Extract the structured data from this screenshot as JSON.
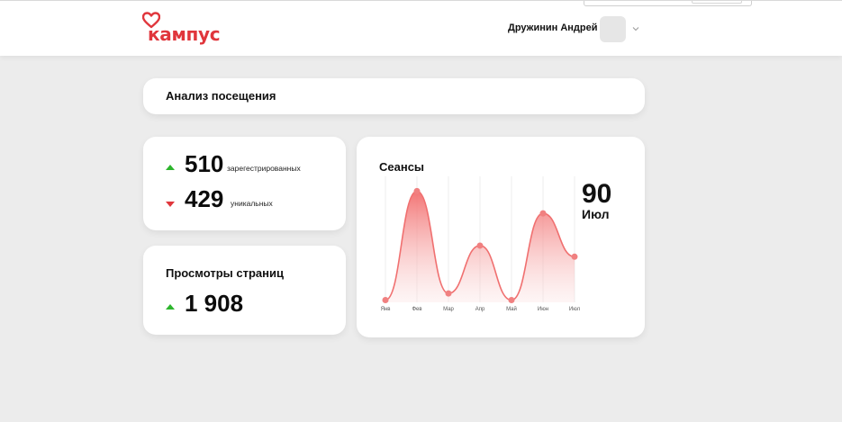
{
  "header": {
    "logo_text": "кампус",
    "user_name": "Дружинин Андрей",
    "brand_color": "#e0363c"
  },
  "page": {
    "title": "Анализ посещения"
  },
  "stats": {
    "registered_value": "510",
    "registered_label": "зарегестрированных",
    "registered_trend": "up",
    "unique_value": "429",
    "unique_label": "уникальных",
    "unique_trend": "down"
  },
  "page_views": {
    "title": "Просмотры страниц",
    "value": "1 908",
    "trend": "up"
  },
  "sessions": {
    "title": "Сеансы",
    "current_value": "90",
    "current_month": "Июл"
  },
  "chart_data": {
    "type": "area",
    "title": "Сеансы",
    "categories": [
      "Янв",
      "Фев",
      "Мар",
      "Апр",
      "Май",
      "Июн",
      "Июл"
    ],
    "values": [
      2,
      100,
      8,
      51,
      2,
      80,
      41
    ],
    "ylim": [
      0,
      110
    ],
    "grid": "vertical",
    "line_color": "#f07070",
    "point_color": "#f08080"
  },
  "colors": {
    "up": "#2db52d",
    "down": "#e0363c",
    "background": "#ececec"
  }
}
